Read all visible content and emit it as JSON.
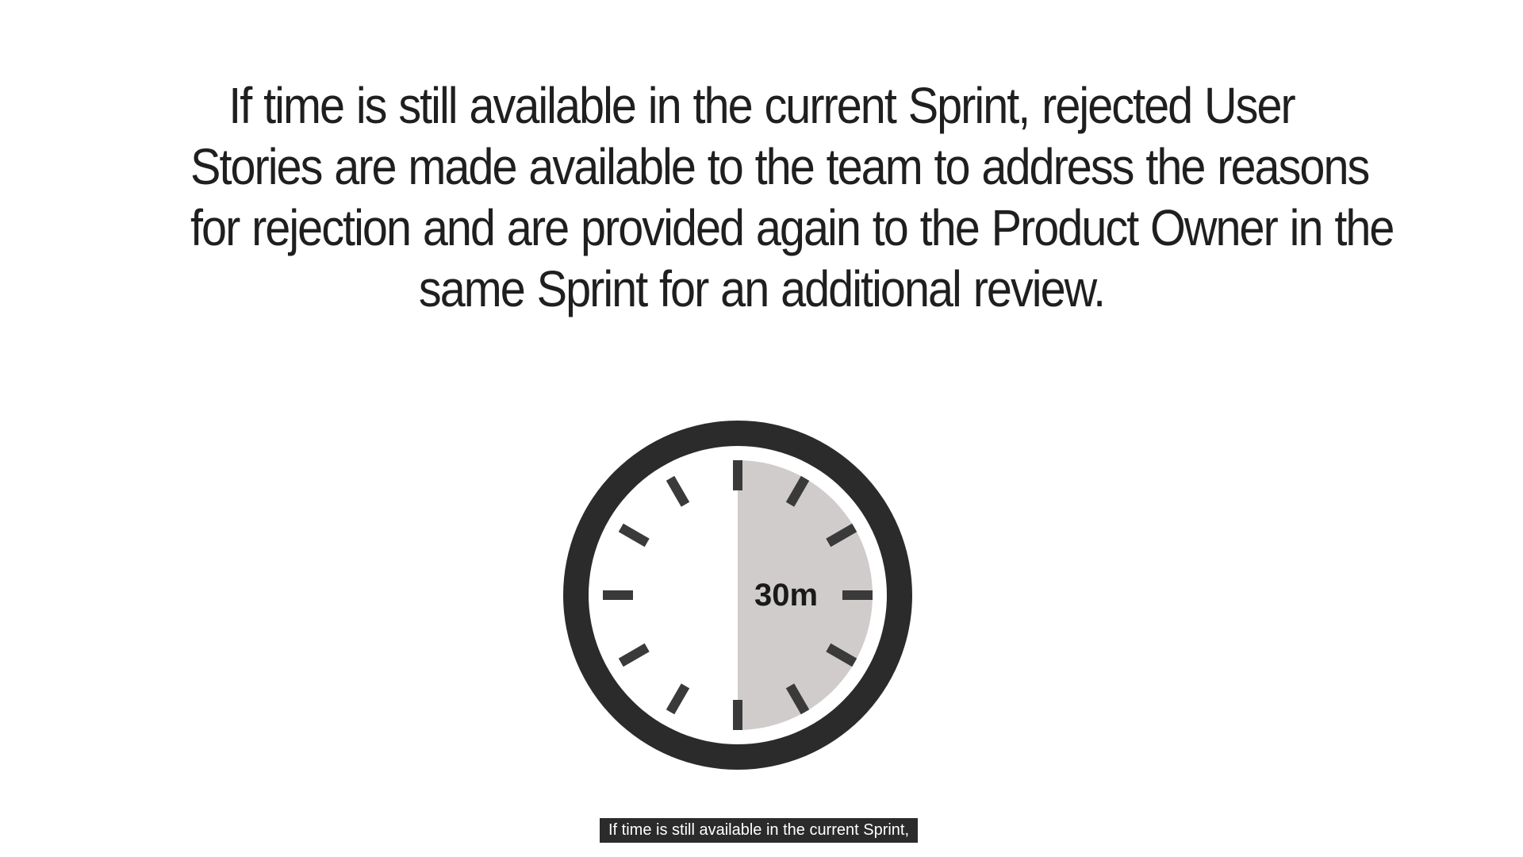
{
  "slide": {
    "headline_lines": [
      "If time is still available in the current Sprint, rejected User",
      "Stories are made available to the team to address the reasons",
      "for rejection and are provided again to the Product Owner in the",
      "same Sprint for an additional review."
    ],
    "timer": {
      "label": "30m",
      "elapsed_fraction": 0.5,
      "ring_color": "#2b2b2b",
      "fill_color": "#cfcccb",
      "tick_color": "#3a3a3a"
    }
  },
  "caption": {
    "text": "If time is still available in the current Sprint,"
  }
}
